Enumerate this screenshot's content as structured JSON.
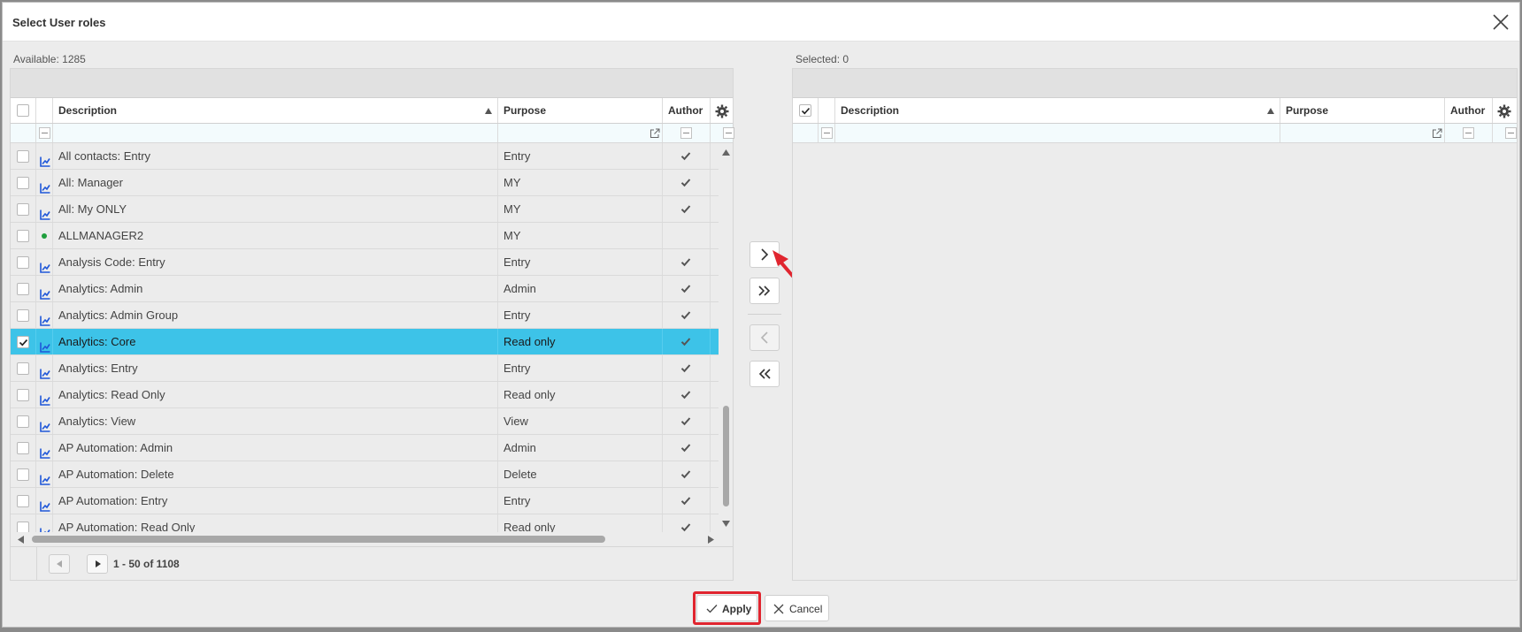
{
  "dialog": {
    "title": "Select User roles"
  },
  "available": {
    "label": "Available: 1285",
    "columns": {
      "description": "Description",
      "purpose": "Purpose",
      "author": "Author"
    },
    "rows": [
      {
        "description": "All contacts: Entry",
        "purpose": "Entry",
        "author": true,
        "icon": "chart-icon",
        "selected": false
      },
      {
        "description": "All: Manager",
        "purpose": "MY",
        "author": true,
        "icon": "chart-icon",
        "selected": false
      },
      {
        "description": "All: My ONLY",
        "purpose": "MY",
        "author": true,
        "icon": "chart-icon",
        "selected": false
      },
      {
        "description": "ALLMANAGER2",
        "purpose": "MY",
        "author": false,
        "icon": "green-dot-icon",
        "selected": false
      },
      {
        "description": "Analysis Code: Entry",
        "purpose": "Entry",
        "author": true,
        "icon": "chart-icon",
        "selected": false
      },
      {
        "description": "Analytics: Admin",
        "purpose": "Admin",
        "author": true,
        "icon": "chart-icon",
        "selected": false
      },
      {
        "description": "Analytics: Admin Group",
        "purpose": "Entry",
        "author": true,
        "icon": "chart-icon",
        "selected": false
      },
      {
        "description": "Analytics: Core",
        "purpose": "Read only",
        "author": true,
        "icon": "chart-icon",
        "selected": true
      },
      {
        "description": "Analytics: Entry",
        "purpose": "Entry",
        "author": true,
        "icon": "chart-icon",
        "selected": false
      },
      {
        "description": "Analytics: Read Only",
        "purpose": "Read only",
        "author": true,
        "icon": "chart-icon",
        "selected": false
      },
      {
        "description": "Analytics: View",
        "purpose": "View",
        "author": true,
        "icon": "chart-icon",
        "selected": false
      },
      {
        "description": "AP Automation: Admin",
        "purpose": "Admin",
        "author": true,
        "icon": "chart-icon",
        "selected": false
      },
      {
        "description": "AP Automation: Delete",
        "purpose": "Delete",
        "author": true,
        "icon": "chart-icon",
        "selected": false
      },
      {
        "description": "AP Automation: Entry",
        "purpose": "Entry",
        "author": true,
        "icon": "chart-icon",
        "selected": false
      },
      {
        "description": "AP Automation: Read Only",
        "purpose": "Read only",
        "author": true,
        "icon": "chart-icon",
        "selected": false
      }
    ],
    "pager_text": "1 - 50 of 1108"
  },
  "selected": {
    "label": "Selected: 0",
    "columns": {
      "description": "Description",
      "purpose": "Purpose",
      "author": "Author"
    }
  },
  "buttons": {
    "apply": "Apply",
    "cancel": "Cancel"
  },
  "colors": {
    "selected_row": "#3dc3e8",
    "annotation": "#e0252f",
    "chart_icon": "#1e56d8",
    "dot": "#1f9e3c"
  }
}
